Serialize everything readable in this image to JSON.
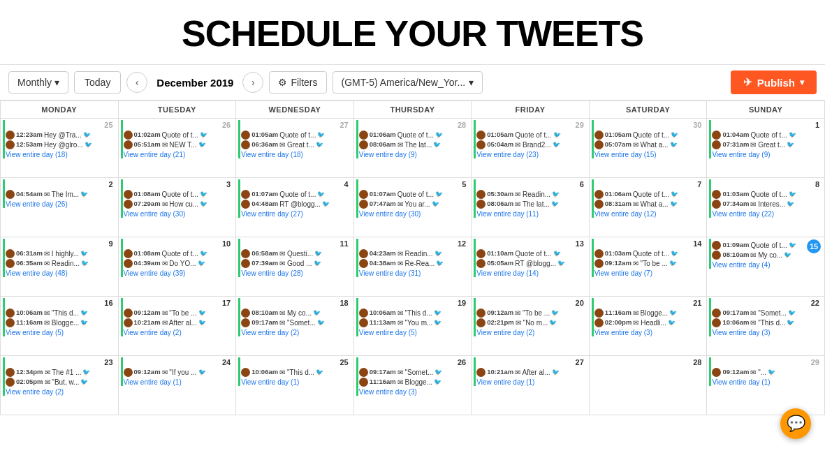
{
  "header": {
    "title": "SCHEDULE YOUR TWEETS"
  },
  "toolbar": {
    "monthly_label": "Monthly",
    "today_label": "Today",
    "prev_label": "‹",
    "next_label": "›",
    "month_label": "December 2019",
    "filters_label": "Filters",
    "timezone_label": "(GMT-5) America/New_Yor...",
    "publish_label": "Publish"
  },
  "calendar": {
    "headers": [
      "MONDAY",
      "TUESDAY",
      "WEDNESDAY",
      "THURSDAY",
      "FRIDAY",
      "SATURDAY",
      "SUNDAY"
    ],
    "weeks": [
      {
        "days": [
          {
            "num": "25",
            "prev": true,
            "tweets": [
              "12:23am Hey @Tra...",
              "12:53am Hey @glro..."
            ],
            "view": "View entire day (18)"
          },
          {
            "num": "26",
            "prev": true,
            "tweets": [
              "01:02am Quote of t...",
              "05:51am ✉ NEW T..."
            ],
            "view": "View entire day (21)"
          },
          {
            "num": "27",
            "prev": true,
            "tweets": [
              "01:05am Quote of t...",
              "06:36am ✉ Great t..."
            ],
            "view": "View entire day (18)"
          },
          {
            "num": "28",
            "prev": true,
            "tweets": [
              "01:06am Quote of t...",
              "08:06am ✉ The lat..."
            ],
            "view": "View entire day (9)"
          },
          {
            "num": "29",
            "prev": true,
            "tweets": [
              "01:05am Quote of t...",
              "05:04am ✉ Brand2..."
            ],
            "view": "View entire day (23)"
          },
          {
            "num": "30",
            "prev": true,
            "tweets": [
              "01:05am Quote of t...",
              "05:07am ✉ What a..."
            ],
            "view": "View entire day (15)"
          },
          {
            "num": "1",
            "prev": false,
            "tweets": [
              "01:04am Quote of t...",
              "07:31am ✉ Great t..."
            ],
            "view": "View entire day (9)"
          }
        ]
      },
      {
        "days": [
          {
            "num": "2",
            "tweets": [
              "04:54am ✉ The Im..."
            ],
            "view": "View entire day (26)"
          },
          {
            "num": "3",
            "tweets": [
              "01:08am Quote of t...",
              "07:29am ✉ How cu..."
            ],
            "view": "View entire day (30)"
          },
          {
            "num": "4",
            "tweets": [
              "01:07am Quote of t...",
              "04:48am RT @blogg..."
            ],
            "view": "View entire day (27)"
          },
          {
            "num": "5",
            "tweets": [
              "01:07am Quote of t...",
              "07:47am ✉ You ar..."
            ],
            "view": "View entire day (30)"
          },
          {
            "num": "6",
            "tweets": [
              "05:30am ✉ Readin...",
              "08:06am ✉ The lat..."
            ],
            "view": "View entire day (11)"
          },
          {
            "num": "7",
            "tweets": [
              "01:06am Quote of t...",
              "08:31am ✉ What a..."
            ],
            "view": "View entire day (12)"
          },
          {
            "num": "8",
            "tweets": [
              "01:03am Quote of t...",
              "07:34am ✉ Interes..."
            ],
            "view": "View entire day (22)"
          }
        ]
      },
      {
        "days": [
          {
            "num": "9",
            "tweets": [
              "06:31am ✉ I highly...",
              "06:35am ✉ Readin..."
            ],
            "view": "View entire day (48)"
          },
          {
            "num": "10",
            "tweets": [
              "01:08am Quote of t...",
              "04:39am ✉ Do YO..."
            ],
            "view": "View entire day (39)"
          },
          {
            "num": "11",
            "tweets": [
              "06:58am ✉ Questi...",
              "07:39am ✉ Good ..."
            ],
            "view": "View entire day (28)"
          },
          {
            "num": "12",
            "tweets": [
              "04:23am ✉ Readin...",
              "04:38am ✉ Re-Rea..."
            ],
            "view": "View entire day (31)"
          },
          {
            "num": "13",
            "tweets": [
              "01:10am Quote of t...",
              "05:05am RT @blogg..."
            ],
            "view": "View entire day (14)"
          },
          {
            "num": "14",
            "tweets": [
              "01:03am Quote of t...",
              "09:12am ✉ \"To be ..."
            ],
            "view": "View entire day (7)"
          },
          {
            "num": "15",
            "today": true,
            "tweets": [
              "01:09am Quote of t...",
              "08:10am ✉ My co..."
            ],
            "view": "View entire day (4)"
          }
        ]
      },
      {
        "days": [
          {
            "num": "16",
            "tweets": [
              "10:06am ✉ \"This d...",
              "11:16am ✉ Blogge..."
            ],
            "view": "View entire day (5)"
          },
          {
            "num": "17",
            "tweets": [
              "09:12am ✉ \"To be ...",
              "10:21am ✉ After al..."
            ],
            "view": "View entire day (2)"
          },
          {
            "num": "18",
            "tweets": [
              "08:10am ✉ My co...",
              "09:17am ✉ \"Somet..."
            ],
            "view": "View entire day (2)"
          },
          {
            "num": "19",
            "tweets": [
              "10:06am ✉ \"This d...",
              "11:13am ✉ \"You m..."
            ],
            "view": "View entire day (5)"
          },
          {
            "num": "20",
            "tweets": [
              "09:12am ✉ \"To be ...",
              "02:21pm ✉ \"No m..."
            ],
            "view": "View entire day (2)"
          },
          {
            "num": "21",
            "tweets": [
              "11:16am ✉ Blogge...",
              "02:00pm ✉ Headli..."
            ],
            "view": "View entire day (3)"
          },
          {
            "num": "22",
            "tweets": [
              "09:17am ✉ \"Somet...",
              "10:06am ✉ \"This d..."
            ],
            "view": "View entire day (3)"
          }
        ]
      },
      {
        "days": [
          {
            "num": "23",
            "tweets": [
              "12:34pm ✉ The #1 ...",
              "02:05pm ✉ \"But, w..."
            ],
            "view": "View entire day (2)"
          },
          {
            "num": "24",
            "tweets": [
              "09:12am ✉ \"If you ..."
            ],
            "view": "View entire day (1)"
          },
          {
            "num": "25",
            "tweets": [
              "10:06am ✉ \"This d..."
            ],
            "view": "View entire day (1)"
          },
          {
            "num": "26",
            "tweets": [
              "09:17am ✉ \"Somet...",
              "11:16am ✉ Blogge..."
            ],
            "view": "View entire day (3)"
          },
          {
            "num": "27",
            "tweets": [
              "10:21am ✉ After al..."
            ],
            "view": "View entire day (1)"
          },
          {
            "num": "28",
            "tweets": [],
            "view": ""
          },
          {
            "num": "29",
            "next": true,
            "tweets": [
              "09:12am ✉ \"..."
            ],
            "view": "View entire day (1)"
          }
        ]
      }
    ]
  }
}
